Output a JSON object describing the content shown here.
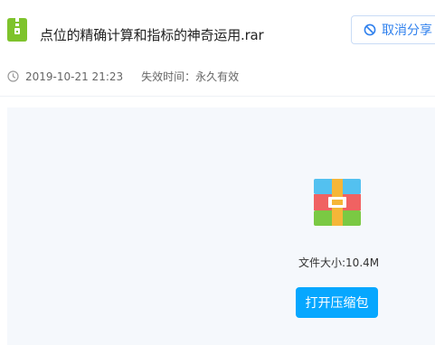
{
  "file": {
    "name": "点位的精确计算和指标的神奇运用.rar",
    "icon": "zip-file-icon"
  },
  "actions": {
    "cancel_share_label": "取消分享",
    "open_archive_label": "打开压缩包"
  },
  "meta": {
    "datetime": "2019-10-21 21:23",
    "expiry": "失效时间：永久有效"
  },
  "details": {
    "file_size": "文件大小:10.4M"
  },
  "colors": {
    "accent": "#06a7ff",
    "link_blue": "#2f80ed",
    "file_icon_green": "#7ec32c"
  }
}
